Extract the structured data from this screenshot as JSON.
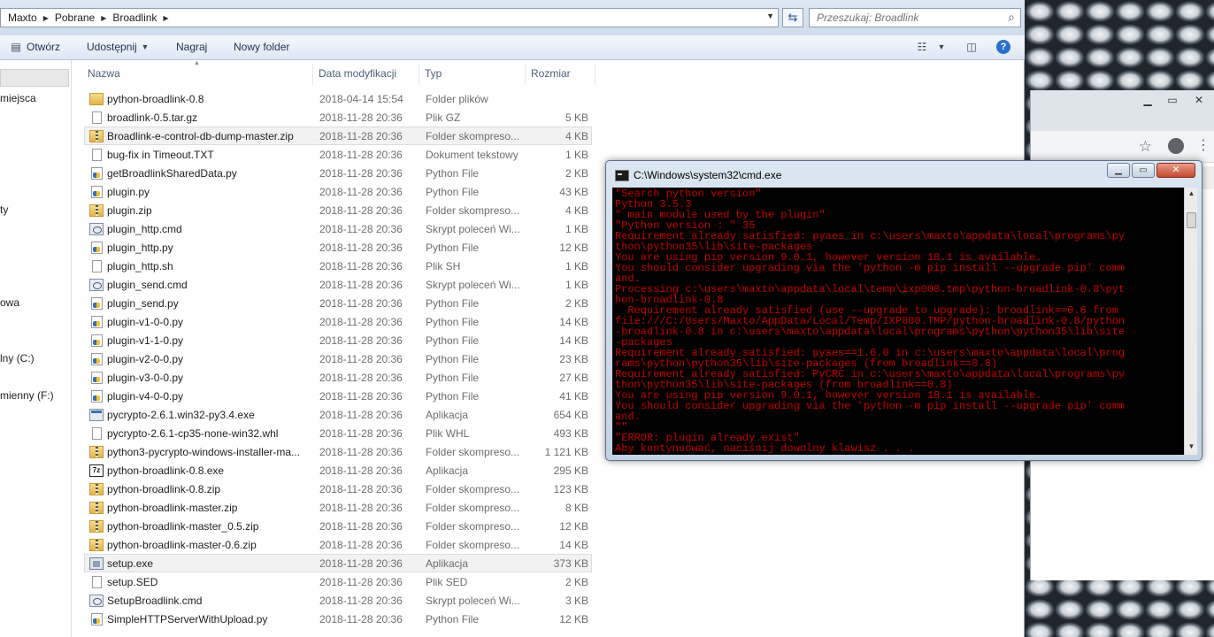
{
  "explorer": {
    "breadcrumb": [
      "Maxto",
      "Pobrane",
      "Broadlink"
    ],
    "search_placeholder": "Przeszukaj: Broadlink",
    "toolbar": {
      "open_label": "Otwórz",
      "share_label": "Udostępnij",
      "burn_label": "Nagraj",
      "new_folder_label": "Nowy folder"
    },
    "navpane": [
      "miejsca",
      "ty",
      "owa",
      "lny (C:)",
      "mienny (F:)"
    ],
    "columns": {
      "name": "Nazwa",
      "date": "Data modyfikacji",
      "type": "Typ",
      "size": "Rozmiar"
    },
    "files": [
      {
        "name": "python-broadlink-0.8",
        "date": "2018-04-14 15:54",
        "type": "Folder plików",
        "size": "",
        "icon": "folder-icon"
      },
      {
        "name": "broadlink-0.5.tar.gz",
        "date": "2018-11-28 20:36",
        "type": "Plik GZ",
        "size": "5 KB",
        "icon": "file-icon"
      },
      {
        "name": "Broadlink-e-control-db-dump-master.zip",
        "date": "2018-11-28 20:36",
        "type": "Folder skompreso...",
        "size": "4 KB",
        "icon": "zip-folder-icon"
      },
      {
        "name": "bug-fix in Timeout.TXT",
        "date": "2018-11-28 20:36",
        "type": "Dokument tekstowy",
        "size": "1 KB",
        "icon": "file-icon"
      },
      {
        "name": "getBroadlinkSharedData.py",
        "date": "2018-11-28 20:36",
        "type": "Python File",
        "size": "2 KB",
        "icon": "python-file-icon"
      },
      {
        "name": "plugin.py",
        "date": "2018-11-28 20:36",
        "type": "Python File",
        "size": "43 KB",
        "icon": "python-file-icon"
      },
      {
        "name": "plugin.zip",
        "date": "2018-11-28 20:36",
        "type": "Folder skompreso...",
        "size": "4 KB",
        "icon": "zip-folder-icon"
      },
      {
        "name": "plugin_http.cmd",
        "date": "2018-11-28 20:36",
        "type": "Skrypt poleceń Wi...",
        "size": "1 KB",
        "icon": "cmd-script-icon"
      },
      {
        "name": "plugin_http.py",
        "date": "2018-11-28 20:36",
        "type": "Python File",
        "size": "12 KB",
        "icon": "python-file-icon"
      },
      {
        "name": "plugin_http.sh",
        "date": "2018-11-28 20:36",
        "type": "Plik SH",
        "size": "1 KB",
        "icon": "file-icon"
      },
      {
        "name": "plugin_send.cmd",
        "date": "2018-11-28 20:36",
        "type": "Skrypt poleceń Wi...",
        "size": "1 KB",
        "icon": "cmd-script-icon"
      },
      {
        "name": "plugin_send.py",
        "date": "2018-11-28 20:36",
        "type": "Python File",
        "size": "2 KB",
        "icon": "python-file-icon"
      },
      {
        "name": "plugin-v1-0-0.py",
        "date": "2018-11-28 20:36",
        "type": "Python File",
        "size": "14 KB",
        "icon": "python-file-icon"
      },
      {
        "name": "plugin-v1-1-0.py",
        "date": "2018-11-28 20:36",
        "type": "Python File",
        "size": "14 KB",
        "icon": "python-file-icon"
      },
      {
        "name": "plugin-v2-0-0.py",
        "date": "2018-11-28 20:36",
        "type": "Python File",
        "size": "23 KB",
        "icon": "python-file-icon"
      },
      {
        "name": "plugin-v3-0-0.py",
        "date": "2018-11-28 20:36",
        "type": "Python File",
        "size": "27 KB",
        "icon": "python-file-icon"
      },
      {
        "name": "plugin-v4-0-0.py",
        "date": "2018-11-28 20:36",
        "type": "Python File",
        "size": "41 KB",
        "icon": "python-file-icon"
      },
      {
        "name": "pycrypto-2.6.1.win32-py3.4.exe",
        "date": "2018-11-28 20:36",
        "type": "Aplikacja",
        "size": "654 KB",
        "icon": "exe-icon"
      },
      {
        "name": "pycrypto-2.6.1-cp35-none-win32.whl",
        "date": "2018-11-28 20:36",
        "type": "Plik WHL",
        "size": "493 KB",
        "icon": "file-icon"
      },
      {
        "name": "python3-pycrypto-windows-installer-ma...",
        "date": "2018-11-28 20:36",
        "type": "Folder skompreso...",
        "size": "1 121 KB",
        "icon": "zip-folder-icon"
      },
      {
        "name": "python-broadlink-0.8.exe",
        "date": "2018-11-28 20:36",
        "type": "Aplikacja",
        "size": "295 KB",
        "icon": "seven-zip-icon"
      },
      {
        "name": "python-broadlink-0.8.zip",
        "date": "2018-11-28 20:36",
        "type": "Folder skompreso...",
        "size": "123 KB",
        "icon": "zip-folder-icon"
      },
      {
        "name": "python-broadlink-master.zip",
        "date": "2018-11-28 20:36",
        "type": "Folder skompreso...",
        "size": "8 KB",
        "icon": "zip-folder-icon"
      },
      {
        "name": "python-broadlink-master_0.5.zip",
        "date": "2018-11-28 20:36",
        "type": "Folder skompreso...",
        "size": "12 KB",
        "icon": "zip-folder-icon"
      },
      {
        "name": "python-broadlink-master-0.6.zip",
        "date": "2018-11-28 20:36",
        "type": "Folder skompreso...",
        "size": "14 KB",
        "icon": "zip-folder-icon"
      },
      {
        "name": "setup.exe",
        "date": "2018-11-28 20:36",
        "type": "Aplikacja",
        "size": "373 KB",
        "icon": "setup-icon"
      },
      {
        "name": "setup.SED",
        "date": "2018-11-28 20:36",
        "type": "Plik SED",
        "size": "2 KB",
        "icon": "file-icon"
      },
      {
        "name": "SetupBroadlink.cmd",
        "date": "2018-11-28 20:36",
        "type": "Skrypt poleceń Wi...",
        "size": "3 KB",
        "icon": "cmd-script-icon"
      },
      {
        "name": "SimpleHTTPServerWithUpload.py",
        "date": "2018-11-28 20:36",
        "type": "Python File",
        "size": "12 KB",
        "icon": "python-file-icon"
      }
    ]
  },
  "cmd": {
    "title": "C:\\Windows\\system32\\cmd.exe",
    "lines": [
      "\"Search python version\"",
      "Python 3.5.3",
      "\" main module used by the plugin\"",
      "\"Python version : \" 35",
      "Requirement already satisfied: pyaes in c:\\users\\maxto\\appdata\\local\\programs\\py",
      "thon\\python35\\lib\\site-packages",
      "You are using pip version 9.0.1, however version 18.1 is available.",
      "You should consider upgrading via the 'python -m pip install --upgrade pip' comm",
      "and.",
      "Processing c:\\users\\maxto\\appdata\\local\\temp\\ixp000.tmp\\python-broadlink-0.8\\pyt",
      "hon-broadlink-0.8",
      "  Requirement already satisfied (use --upgrade to upgrade): broadlink==0.8 from",
      "file:///C:/Users/Maxto/AppData/Local/Temp/IXP000.TMP/python-broadlink-0.8/python",
      "-broadlink-0.8 in c:\\users\\maxto\\appdata\\local\\programs\\python\\python35\\lib\\site",
      "-packages",
      "Requirement already satisfied: pyaes==1.6.0 in c:\\users\\maxto\\appdata\\local\\prog",
      "rams\\python\\python35\\lib\\site-packages (from broadlink==0.8)",
      "Requirement already satisfied: PyCRC in c:\\users\\maxto\\appdata\\local\\programs\\py",
      "thon\\python35\\lib\\site-packages (from broadlink==0.8)",
      "You are using pip version 9.0.1, however version 18.1 is available.",
      "You should consider upgrading via the 'python -m pip install --upgrade pip' comm",
      "and.",
      "\"\"",
      "\"ERROR: plugin already exist\"",
      "Aby kontynuować, naciśnij dowolny klawisz . . ."
    ]
  },
  "colors": {
    "console_text": "#c30000",
    "console_bg": "#000000",
    "selection_row": "#f2f2f2"
  }
}
